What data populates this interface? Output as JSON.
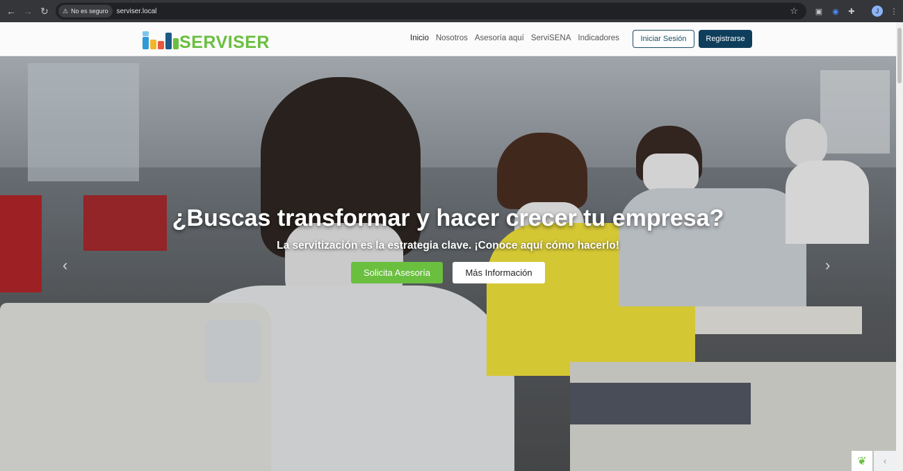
{
  "browser": {
    "security_label": "No es seguro",
    "url": "serviser.local"
  },
  "navbar": {
    "logo_text": "SERVISER",
    "menu": [
      "Inicio",
      "Nosotros",
      "Asesoría aquí",
      "ServiSENA",
      "Indicadores"
    ],
    "login_label": "Iniciar Sesión",
    "register_label": "Registrarse"
  },
  "hero": {
    "title": "¿Buscas transformar y hacer crecer tu empresa?",
    "subtitle": "La servitización es la estrategia clave. ¡Conoce aquí cómo hacerlo!",
    "primary_button": "Solicita Asesoría",
    "secondary_button": "Más Información",
    "prev_icon": "chevron-left-icon",
    "next_icon": "chevron-right-icon"
  },
  "colors": {
    "brand_green": "#6abf3f",
    "brand_navy": "#0f3e5c"
  }
}
